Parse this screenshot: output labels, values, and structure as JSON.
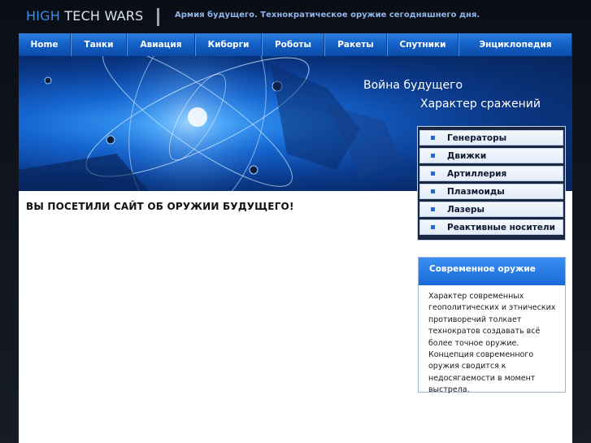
{
  "header": {
    "logo_part1": "HIGH",
    "logo_part2": "TECH WARS",
    "tagline": "Армия будущего. Технократическое оружие сегодняшнего дня."
  },
  "nav": {
    "items": [
      {
        "label": "Home"
      },
      {
        "label": "Танки"
      },
      {
        "label": "Авиация"
      },
      {
        "label": "Киборги"
      },
      {
        "label": "Роботы"
      },
      {
        "label": "Ракеты"
      },
      {
        "label": "Спутники"
      },
      {
        "label": "Энциклопедия"
      }
    ]
  },
  "banner": {
    "title1": "Война будущего",
    "title2": "Характер сражений"
  },
  "main": {
    "heading": "ВЫ ПОСЕТИЛИ САЙТ ОБ ОРУЖИИ БУДУЩЕГО!"
  },
  "side_menu": {
    "items": [
      {
        "label": "Генераторы"
      },
      {
        "label": "Движки"
      },
      {
        "label": "Артиллерия"
      },
      {
        "label": "Плазмоиды"
      },
      {
        "label": "Лазеры"
      },
      {
        "label": "Реактивные носители"
      }
    ]
  },
  "info_box": {
    "title": "Современное оружие",
    "text": "Характер современных геополитических и этнических противоречий толкает технократов создавать всё более точное оружие. Концепция современного оружия сводится к недосягаемости       в момент выстрела."
  },
  "colors": {
    "accent": "#1462c9",
    "logo_accent": "#3d8ee8",
    "background": "#06080d"
  }
}
